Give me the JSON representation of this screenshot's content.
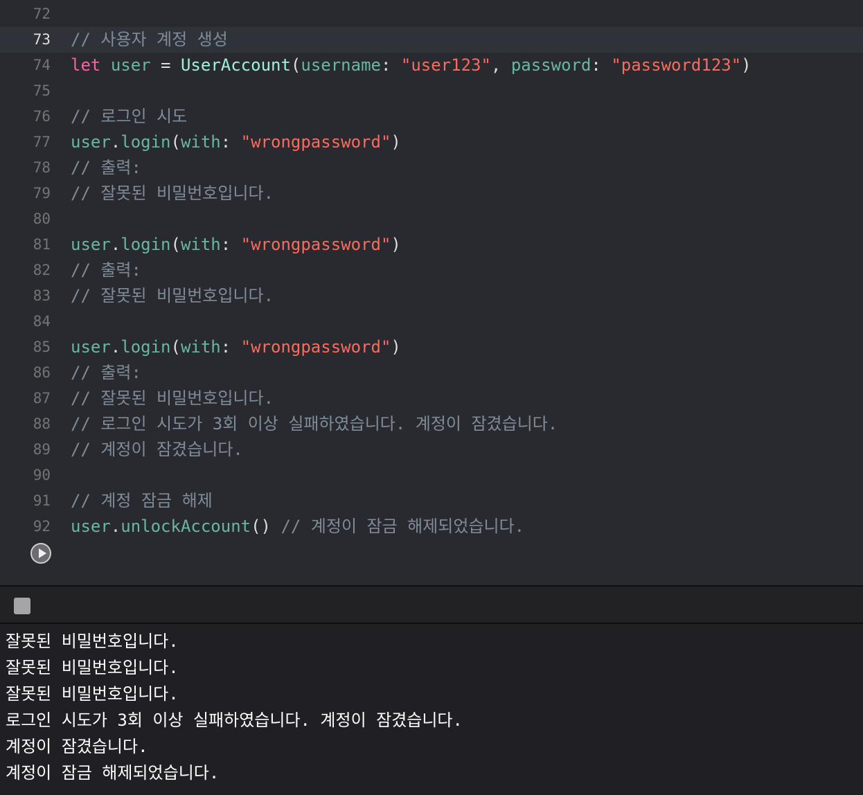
{
  "editor": {
    "current_line": "73",
    "lines": [
      {
        "num": "72",
        "tokens": []
      },
      {
        "num": "73",
        "tokens": [
          {
            "t": "comment",
            "v": "// 사용자 계정 생성"
          }
        ]
      },
      {
        "num": "74",
        "tokens": [
          {
            "t": "keyword",
            "v": "let"
          },
          {
            "t": "plain",
            "v": " "
          },
          {
            "t": "var",
            "v": "user"
          },
          {
            "t": "plain",
            "v": " = "
          },
          {
            "t": "type",
            "v": "UserAccount"
          },
          {
            "t": "plain",
            "v": "("
          },
          {
            "t": "param",
            "v": "username"
          },
          {
            "t": "plain",
            "v": ": "
          },
          {
            "t": "string",
            "v": "\"user123\""
          },
          {
            "t": "plain",
            "v": ", "
          },
          {
            "t": "param",
            "v": "password"
          },
          {
            "t": "plain",
            "v": ": "
          },
          {
            "t": "string",
            "v": "\"password123\""
          },
          {
            "t": "plain",
            "v": ")"
          }
        ]
      },
      {
        "num": "75",
        "tokens": []
      },
      {
        "num": "76",
        "tokens": [
          {
            "t": "comment",
            "v": "// 로그인 시도"
          }
        ]
      },
      {
        "num": "77",
        "tokens": [
          {
            "t": "func",
            "v": "user"
          },
          {
            "t": "plain",
            "v": "."
          },
          {
            "t": "func",
            "v": "login"
          },
          {
            "t": "plain",
            "v": "("
          },
          {
            "t": "param",
            "v": "with"
          },
          {
            "t": "plain",
            "v": ": "
          },
          {
            "t": "string",
            "v": "\"wrongpassword\""
          },
          {
            "t": "plain",
            "v": ")"
          }
        ]
      },
      {
        "num": "78",
        "tokens": [
          {
            "t": "comment",
            "v": "// 출력:"
          }
        ]
      },
      {
        "num": "79",
        "tokens": [
          {
            "t": "comment",
            "v": "// 잘못된 비밀번호입니다."
          }
        ]
      },
      {
        "num": "80",
        "tokens": []
      },
      {
        "num": "81",
        "tokens": [
          {
            "t": "func",
            "v": "user"
          },
          {
            "t": "plain",
            "v": "."
          },
          {
            "t": "func",
            "v": "login"
          },
          {
            "t": "plain",
            "v": "("
          },
          {
            "t": "param",
            "v": "with"
          },
          {
            "t": "plain",
            "v": ": "
          },
          {
            "t": "string",
            "v": "\"wrongpassword\""
          },
          {
            "t": "plain",
            "v": ")"
          }
        ]
      },
      {
        "num": "82",
        "tokens": [
          {
            "t": "comment",
            "v": "// 출력:"
          }
        ]
      },
      {
        "num": "83",
        "tokens": [
          {
            "t": "comment",
            "v": "// 잘못된 비밀번호입니다."
          }
        ]
      },
      {
        "num": "84",
        "tokens": []
      },
      {
        "num": "85",
        "tokens": [
          {
            "t": "func",
            "v": "user"
          },
          {
            "t": "plain",
            "v": "."
          },
          {
            "t": "func",
            "v": "login"
          },
          {
            "t": "plain",
            "v": "("
          },
          {
            "t": "param",
            "v": "with"
          },
          {
            "t": "plain",
            "v": ": "
          },
          {
            "t": "string",
            "v": "\"wrongpassword\""
          },
          {
            "t": "plain",
            "v": ")"
          }
        ]
      },
      {
        "num": "86",
        "tokens": [
          {
            "t": "comment",
            "v": "// 출력:"
          }
        ]
      },
      {
        "num": "87",
        "tokens": [
          {
            "t": "comment",
            "v": "// 잘못된 비밀번호입니다."
          }
        ]
      },
      {
        "num": "88",
        "tokens": [
          {
            "t": "comment",
            "v": "// 로그인 시도가 3회 이상 실패하였습니다. 계정이 잠겼습니다."
          }
        ]
      },
      {
        "num": "89",
        "tokens": [
          {
            "t": "comment",
            "v": "// 계정이 잠겼습니다."
          }
        ]
      },
      {
        "num": "90",
        "tokens": []
      },
      {
        "num": "91",
        "tokens": [
          {
            "t": "comment",
            "v": "// 계정 잠금 해제"
          }
        ]
      },
      {
        "num": "92",
        "tokens": [
          {
            "t": "func",
            "v": "user"
          },
          {
            "t": "plain",
            "v": "."
          },
          {
            "t": "func",
            "v": "unlockAccount"
          },
          {
            "t": "plain",
            "v": "() "
          },
          {
            "t": "comment",
            "v": "// 계정이 잠금 해제되었습니다."
          }
        ]
      }
    ]
  },
  "run_button": {
    "icon": "play-circle-icon"
  },
  "debug_bar": {
    "stop_icon": "stop-icon"
  },
  "console": {
    "output": [
      "잘못된 비밀번호입니다.",
      "잘못된 비밀번호입니다.",
      "잘못된 비밀번호입니다.",
      "로그인 시도가 3회 이상 실패하였습니다. 계정이 잠겼습니다.",
      "계정이 잠겼습니다.",
      "계정이 잠금 해제되었습니다."
    ]
  },
  "colors": {
    "editor_bg": "#292a30",
    "current_line_bg": "#2f3239",
    "comment": "#7f8c98",
    "keyword": "#fc5fa3",
    "string": "#fc6a5d",
    "identifier": "#67b7a4",
    "type": "#9ef1dd",
    "console_bg": "#1f1f24"
  }
}
